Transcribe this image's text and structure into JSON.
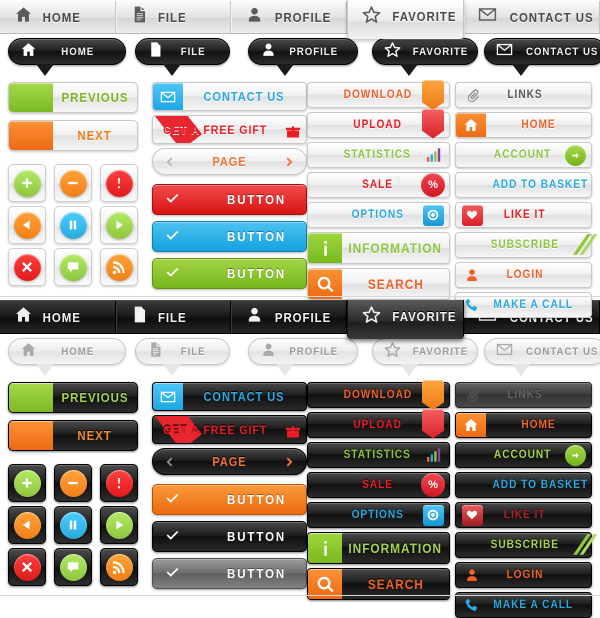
{
  "nav_light": {
    "style": "light",
    "active_index": 3,
    "items": [
      {
        "label": "HOME",
        "icon": "home-icon"
      },
      {
        "label": "FILE",
        "icon": "file-icon"
      },
      {
        "label": "PROFILE",
        "icon": "user-icon"
      },
      {
        "label": "FAVORITE",
        "icon": "star-icon"
      },
      {
        "label": "CONTACT US",
        "icon": "envelope-icon"
      }
    ]
  },
  "nav_dark": {
    "style": "dark",
    "active_index": 3,
    "items": [
      {
        "label": "HOME",
        "icon": "home-icon"
      },
      {
        "label": "FILE",
        "icon": "file-icon"
      },
      {
        "label": "PROFILE",
        "icon": "user-icon"
      },
      {
        "label": "FAVORITE",
        "icon": "star-icon"
      },
      {
        "label": "CONTACT US",
        "icon": "envelope-icon"
      }
    ]
  },
  "bubbles_dark": [
    {
      "label": "HOME",
      "icon": "home-icon"
    },
    {
      "label": "FILE",
      "icon": "file-icon"
    },
    {
      "label": "PROFILE",
      "icon": "user-icon"
    },
    {
      "label": "FAVORITE",
      "icon": "star-icon"
    },
    {
      "label": "CONTACT US",
      "icon": "envelope-icon"
    }
  ],
  "bubbles_gray": [
    {
      "label": "HOME",
      "icon": "home-icon"
    },
    {
      "label": "FILE",
      "icon": "file-icon"
    },
    {
      "label": "PROFILE",
      "icon": "user-icon"
    },
    {
      "label": "FAVORITE",
      "icon": "star-icon"
    },
    {
      "label": "CONTACT US",
      "icon": "envelope-icon"
    }
  ],
  "pager_light": {
    "previous": {
      "label": "PREVIOUS",
      "icon": "double-chevron-right-icon",
      "accent": "#8ec63f",
      "text_color": "#7ab51d"
    },
    "next": {
      "label": "NEXT",
      "icon": "double-chevron-left-icon",
      "accent": "#f07f16",
      "text_color": "#ef7e1b"
    }
  },
  "pager_dark": {
    "previous": {
      "label": "PREVIOUS",
      "icon": "double-chevron-right-icon",
      "accent": "#8ec63f",
      "text_color": "#a6d44e"
    },
    "next": {
      "label": "NEXT",
      "icon": "double-chevron-left-icon",
      "accent": "#f07f16",
      "text_color": "#f08a30"
    }
  },
  "icon_tiles_light": [
    {
      "icon": "plus-icon",
      "color": "#8ec63f"
    },
    {
      "icon": "minus-icon",
      "color": "#f07f16"
    },
    {
      "icon": "exclamation-icon",
      "color": "#e01b1b"
    },
    {
      "icon": "previous-triangle-icon",
      "color": "#f07f16"
    },
    {
      "icon": "pause-icon",
      "color": "#28a9e0"
    },
    {
      "icon": "play-triangle-icon",
      "color": "#8ec63f"
    },
    {
      "icon": "close-x-icon",
      "color": "#e01b1b"
    },
    {
      "icon": "comment-icon",
      "color": "#8ec63f"
    },
    {
      "icon": "rss-icon",
      "color": "#f07f16"
    }
  ],
  "icon_tiles_dark": [
    {
      "icon": "plus-icon",
      "color": "#8ec63f"
    },
    {
      "icon": "minus-icon",
      "color": "#f07f16"
    },
    {
      "icon": "exclamation-icon",
      "color": "#e01b1b"
    },
    {
      "icon": "previous-triangle-icon",
      "color": "#f07f16"
    },
    {
      "icon": "pause-icon",
      "color": "#28a9e0"
    },
    {
      "icon": "play-triangle-icon",
      "color": "#8ec63f"
    },
    {
      "icon": "close-x-icon",
      "color": "#e01b1b"
    },
    {
      "icon": "comment-icon",
      "color": "#8ec63f"
    },
    {
      "icon": "rss-icon",
      "color": "#f07f16"
    }
  ],
  "col2_light": {
    "contact": {
      "label": "CONTACT US",
      "icon": "envelope-icon",
      "text_color": "#29a9e1",
      "cap_color": "blue"
    },
    "gift": {
      "label": "GET A FREE GIFT",
      "icon": "gift-icon",
      "text_color": "#ec1c24",
      "ribbon_color": "#e8262f"
    },
    "page": {
      "label": "PAGE",
      "prev_icon": "chevron-left-icon",
      "next_icon": "chevron-right-icon",
      "text_color": "#f0743a"
    },
    "buttons": [
      {
        "label": "BUTTON",
        "color": "c-red",
        "icon": "check-icon"
      },
      {
        "label": "BUTTON",
        "color": "c-blue",
        "icon": "check-icon"
      },
      {
        "label": "BUTTON",
        "color": "c-green",
        "icon": "check-icon"
      }
    ]
  },
  "col2_dark": {
    "contact": {
      "label": "CONTACT US",
      "icon": "envelope-icon",
      "text_color": "#29a9e1",
      "cap_color": "blue"
    },
    "gift": {
      "label": "GET A FREE GIFT",
      "icon": "gift-icon",
      "text_color": "#ec1c24",
      "ribbon_color": "#e8262f"
    },
    "page": {
      "label": "PAGE",
      "prev_icon": "chevron-left-icon",
      "next_icon": "chevron-right-icon",
      "text_color": "#f0743a"
    },
    "buttons": [
      {
        "label": "BUTTON",
        "color": "c-orange",
        "icon": "check-icon"
      },
      {
        "label": "BUTTON",
        "color": "c-black",
        "icon": "check-icon"
      },
      {
        "label": "BUTTON",
        "color": "c-gray",
        "icon": "check-icon"
      }
    ]
  },
  "col3_light": [
    {
      "label": "DOWNLOAD",
      "icon": "download-badge-icon",
      "text_color": "#f0612a",
      "side": "right"
    },
    {
      "label": "UPLOAD",
      "icon": "upload-badge-icon",
      "text_color": "#ec1c24",
      "side": "right"
    },
    {
      "label": "STATISTICS",
      "icon": "bar-chart-icon",
      "text_color": "#8ec63f",
      "side": "right"
    },
    {
      "label": "SALE",
      "icon": "percent-badge-icon",
      "text_color": "#ec1c24",
      "side": "right"
    },
    {
      "label": "OPTIONS",
      "icon": "gear-icon",
      "text_color": "#29a9e1",
      "side": "right"
    },
    {
      "label": "INFORMATION",
      "icon": "info-i-icon",
      "text_color": "#8ec63f",
      "side": "cap-left",
      "cap": "lime"
    },
    {
      "label": "SEARCH",
      "icon": "search-icon",
      "text_color": "#f0612a",
      "side": "cap-left",
      "cap": "orange"
    }
  ],
  "col3_dark": [
    {
      "label": "DOWNLOAD",
      "icon": "download-badge-icon",
      "text_color": "#f0612a",
      "side": "right"
    },
    {
      "label": "UPLOAD",
      "icon": "upload-badge-icon",
      "text_color": "#ec1c24",
      "side": "right"
    },
    {
      "label": "STATISTICS",
      "icon": "bar-chart-icon",
      "text_color": "#8ec63f",
      "side": "right"
    },
    {
      "label": "SALE",
      "icon": "percent-badge-icon",
      "text_color": "#ec1c24",
      "side": "right"
    },
    {
      "label": "OPTIONS",
      "icon": "gear-icon",
      "text_color": "#29a9e1",
      "side": "right"
    },
    {
      "label": "INFORMATION",
      "icon": "info-i-icon",
      "text_color": "#a6d44e",
      "side": "cap-left",
      "cap": "lime"
    },
    {
      "label": "SEARCH",
      "icon": "search-icon",
      "text_color": "#f0612a",
      "side": "cap-left",
      "cap": "orange"
    }
  ],
  "col4_light": [
    {
      "label": "LINKS",
      "icon": "paperclip-icon",
      "text_color": "#5a5a5a",
      "side": "left-plain",
      "disabled": false
    },
    {
      "label": "HOME",
      "icon": "home-icon",
      "text_color": "#f0612a",
      "side": "cap-left",
      "cap": "orange"
    },
    {
      "label": "ACCOUNT",
      "icon": "arrow-right-circle-icon",
      "text_color": "#8ec63f",
      "side": "right"
    },
    {
      "label": "ADD TO BASKET",
      "icon": "cart-icon",
      "text_color": "#29a9e1",
      "side": "right"
    },
    {
      "label": "LIKE IT",
      "icon": "heart-icon",
      "text_color": "#ec1c24",
      "side": "left-plain"
    },
    {
      "label": "SUBSCRIBE",
      "icon": "ribbon-stripes-icon",
      "text_color": "#8ec63f",
      "side": "right"
    },
    {
      "label": "LOGIN",
      "icon": "user-icon",
      "text_color": "#f0612a",
      "side": "left-plain"
    },
    {
      "label": "MAKE A CALL",
      "icon": "phone-icon",
      "text_color": "#29a9e1",
      "side": "left-plain"
    }
  ],
  "col4_dark": [
    {
      "label": "LINKS",
      "icon": "paperclip-icon",
      "text_color": "#4a4a4a",
      "side": "left-plain",
      "disabled": true
    },
    {
      "label": "HOME",
      "icon": "home-icon",
      "text_color": "#f0612a",
      "side": "cap-left",
      "cap": "orange"
    },
    {
      "label": "ACCOUNT",
      "icon": "arrow-right-circle-icon",
      "text_color": "#a6d44e",
      "side": "right"
    },
    {
      "label": "ADD TO BASKET",
      "icon": "cart-icon",
      "text_color": "#29a9e1",
      "side": "right"
    },
    {
      "label": "LIKE IT",
      "icon": "heart-icon",
      "text_color": "#b0222a",
      "side": "left-plain"
    },
    {
      "label": "SUBSCRIBE",
      "icon": "ribbon-stripes-icon",
      "text_color": "#a6d44e",
      "side": "right"
    },
    {
      "label": "LOGIN",
      "icon": "user-icon",
      "text_color": "#f0612a",
      "side": "left-plain"
    },
    {
      "label": "MAKE A CALL",
      "icon": "phone-icon",
      "text_color": "#29a9e1",
      "side": "left-plain"
    }
  ],
  "palette": {
    "green": "#8ec63f",
    "orange": "#f07f16",
    "red": "#e01b1b",
    "blue": "#28a9e0",
    "light_bg": "#f0f0f0",
    "dark_bg": "#131313"
  }
}
